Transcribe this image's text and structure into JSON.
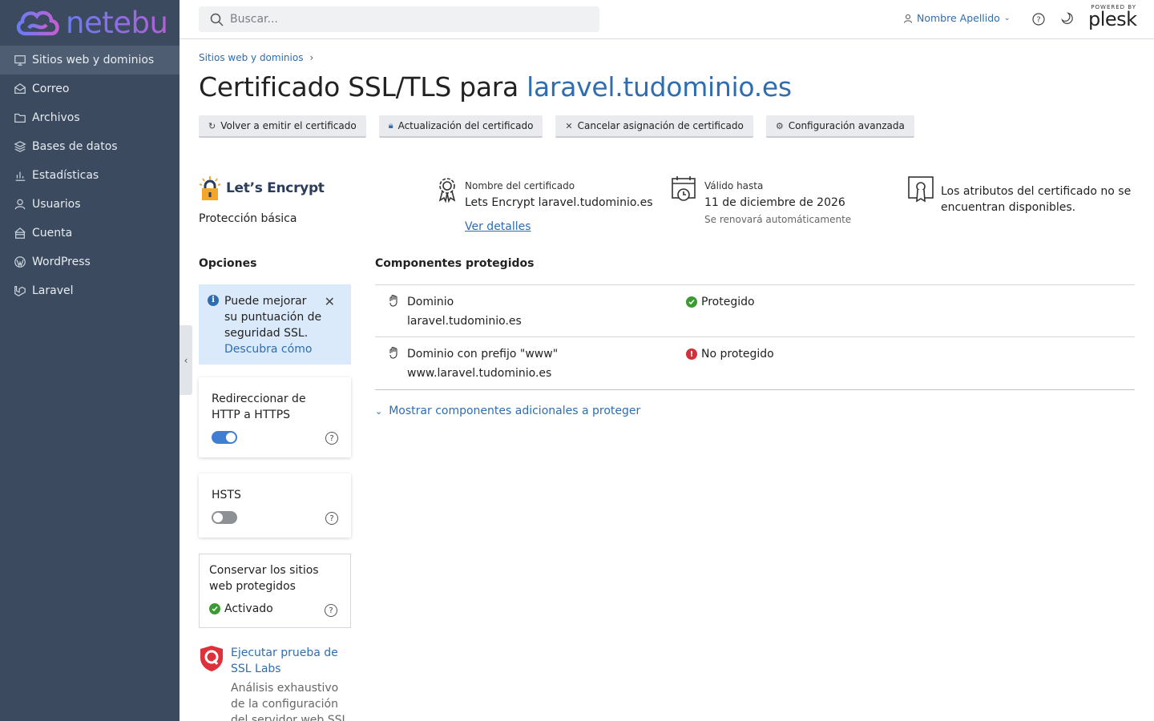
{
  "brand": {
    "logo_text": "netebu"
  },
  "sidebar": {
    "items": [
      {
        "label": "Sitios web y dominios",
        "icon": "monitor-icon",
        "active": true
      },
      {
        "label": "Correo",
        "icon": "mail-icon"
      },
      {
        "label": "Archivos",
        "icon": "folder-icon"
      },
      {
        "label": "Bases de datos",
        "icon": "database-icon"
      },
      {
        "label": "Estadísticas",
        "icon": "bar-chart-icon"
      },
      {
        "label": "Usuarios",
        "icon": "user-icon"
      },
      {
        "label": "Cuenta",
        "icon": "account-icon"
      },
      {
        "label": "WordPress",
        "icon": "wordpress-icon"
      },
      {
        "label": "Laravel",
        "icon": "laravel-icon"
      }
    ]
  },
  "topbar": {
    "search_placeholder": "Buscar...",
    "user_name": "Nombre Apellido",
    "powered_by": "POWERED BY",
    "plesk": "plesk"
  },
  "breadcrumb": {
    "item": "Sitios web y dominios"
  },
  "page": {
    "title_prefix": "Certificado SSL/TLS para ",
    "title_domain": "laravel.tudominio.es"
  },
  "toolbar": {
    "reissue": "Volver a emitir el certificado",
    "upgrade": "Actualización del certificado",
    "unassign": "Cancelar asignación de certificado",
    "advanced": "Configuración avanzada"
  },
  "certificate": {
    "provider": "Let’s Encrypt",
    "protection": "Protección básica",
    "name_label": "Nombre del certificado",
    "name_value": "Lets Encrypt laravel.tudominio.es",
    "details_link": "Ver detalles",
    "valid_label": "Válido hasta",
    "valid_value": "11 de diciembre de 2026",
    "valid_sub": "Se renovará automáticamente",
    "attributes_text": "Los atributos del certificado no se encuentran disponibles."
  },
  "options": {
    "title": "Opciones",
    "tip_text": "Puede mejorar su puntuación de seguridad SSL.",
    "tip_link": "Descubra cómo",
    "redirect_label": "Redireccionar de HTTP a HTTPS",
    "redirect_on": true,
    "hsts_label": "HSTS",
    "hsts_on": false,
    "keep_label": "Conservar los sitios web protegidos",
    "keep_status": "Activado",
    "ssl_labs_link": "Ejecutar prueba de SSL Labs",
    "ssl_labs_desc": "Análisis exhaustivo de la configuración del servidor web SSL"
  },
  "components": {
    "title": "Componentes protegidos",
    "rows": [
      {
        "name": "Dominio",
        "domain": "laravel.tudominio.es",
        "status": "Protegido",
        "ok": true
      },
      {
        "name": "Dominio con prefijo \"www\"",
        "domain": "www.laravel.tudominio.es",
        "status": "No protegido",
        "ok": false
      }
    ],
    "more_link": "Mostrar componentes adicionales a proteger"
  },
  "colors": {
    "sidebar_bg": "#3b4a5e",
    "accent": "#2e6db0",
    "ok": "#3c9a33",
    "error": "#d0313a"
  }
}
